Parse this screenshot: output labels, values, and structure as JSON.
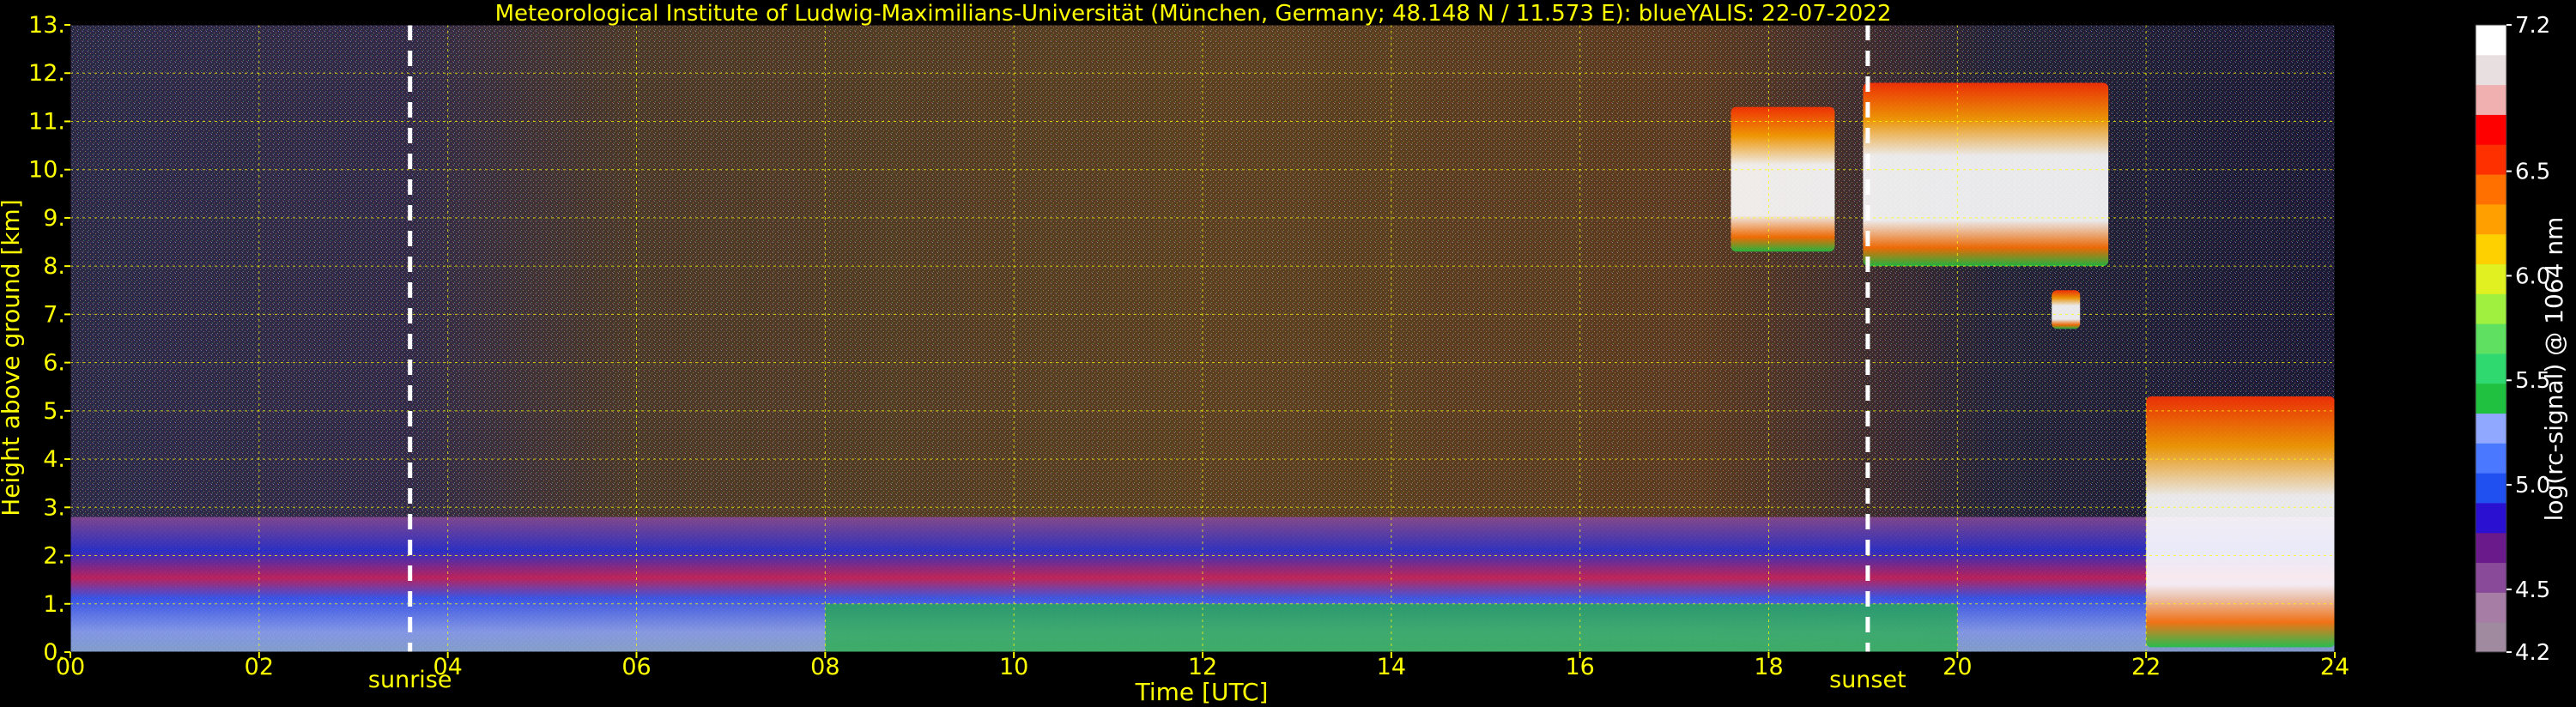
{
  "chart_data": {
    "type": "heatmap",
    "title": "Meteorological Institute of Ludwig-Maximilians-Universität (München, Germany; 48.148 N / 11.573 E):    blueYALIS: 22-07-2022",
    "xlabel": "Time [UTC]",
    "ylabel": "Height above ground [km]",
    "xlim": [
      0,
      24
    ],
    "ylim": [
      0,
      13
    ],
    "x_ticks": [
      {
        "value": 0,
        "label": "00"
      },
      {
        "value": 2,
        "label": "02"
      },
      {
        "value": 4,
        "label": "04"
      },
      {
        "value": 6,
        "label": "06"
      },
      {
        "value": 8,
        "label": "08"
      },
      {
        "value": 10,
        "label": "10"
      },
      {
        "value": 12,
        "label": "12"
      },
      {
        "value": 14,
        "label": "14"
      },
      {
        "value": 16,
        "label": "16"
      },
      {
        "value": 18,
        "label": "18"
      },
      {
        "value": 20,
        "label": "20"
      },
      {
        "value": 22,
        "label": "22"
      },
      {
        "value": 24,
        "label": "24"
      }
    ],
    "y_ticks": [
      {
        "value": 0,
        "label": "0."
      },
      {
        "value": 1,
        "label": "1."
      },
      {
        "value": 2,
        "label": "2."
      },
      {
        "value": 3,
        "label": "3."
      },
      {
        "value": 4,
        "label": "4."
      },
      {
        "value": 5,
        "label": "5."
      },
      {
        "value": 6,
        "label": "6."
      },
      {
        "value": 7,
        "label": "7."
      },
      {
        "value": 8,
        "label": "8."
      },
      {
        "value": 9,
        "label": "9."
      },
      {
        "value": 10,
        "label": "10."
      },
      {
        "value": 11,
        "label": "11."
      },
      {
        "value": 12,
        "label": "12."
      },
      {
        "value": 13,
        "label": "13."
      }
    ],
    "grid": true,
    "annotations": [
      {
        "label": "sunrise",
        "x": 3.6
      },
      {
        "label": "sunset",
        "x": 19.05
      }
    ],
    "colorbar": {
      "label": "log(rc-signal) @ 1064 nm",
      "range": [
        4.2,
        7.2
      ],
      "ticks": [
        4.2,
        4.5,
        5.0,
        5.5,
        6.0,
        6.5,
        7.2
      ],
      "colors": [
        "#a08aa0",
        "#a57da5",
        "#8a4a9a",
        "#6a1a8a",
        "#2a10d0",
        "#2050f0",
        "#4a78ff",
        "#90a8ff",
        "#20c040",
        "#30d870",
        "#60e060",
        "#a0f040",
        "#e0f020",
        "#ffd000",
        "#ffa000",
        "#ff7000",
        "#ff3000",
        "#ff0000",
        "#f0b0b0",
        "#e8e0e0",
        "#ffffff"
      ]
    },
    "layers": [
      {
        "feature": "boundary layer aerosol",
        "x": [
          0,
          24
        ],
        "height_km": [
          0,
          2.8
        ]
      },
      {
        "feature": "cirrus cloud",
        "x": [
          17.6,
          18.7
        ],
        "height_km": [
          8.3,
          11.3
        ]
      },
      {
        "feature": "cirrus cloud",
        "x": [
          19.0,
          21.6
        ],
        "height_km": [
          8.0,
          11.8
        ]
      },
      {
        "feature": "mid-level cloud",
        "x": [
          21.0,
          21.3
        ],
        "height_km": [
          6.7,
          7.5
        ]
      },
      {
        "feature": "low cloud",
        "x": [
          22.0,
          24.0
        ],
        "height_km": [
          0.1,
          5.3
        ]
      }
    ]
  }
}
